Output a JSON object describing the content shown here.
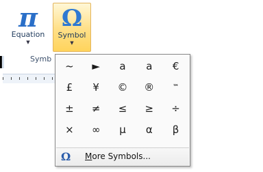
{
  "ribbon": {
    "equation": {
      "glyph": "π",
      "label": "Equation"
    },
    "symbol": {
      "glyph": "Ω",
      "label": "Symbol"
    },
    "group_label": "Symb"
  },
  "gallery": {
    "symbols": [
      "~",
      "►",
      "a",
      "a",
      "€",
      "£",
      "¥",
      "©",
      "®",
      "™",
      "±",
      "≠",
      "≤",
      "≥",
      "÷",
      "×",
      "∞",
      "µ",
      "α",
      "β"
    ],
    "more_icon": "Ω",
    "more_label_mnemonic": "M",
    "more_label_rest": "ore Symbols..."
  },
  "colors": {
    "accent": "#2f79d2",
    "highlight": "#ffe08a"
  }
}
